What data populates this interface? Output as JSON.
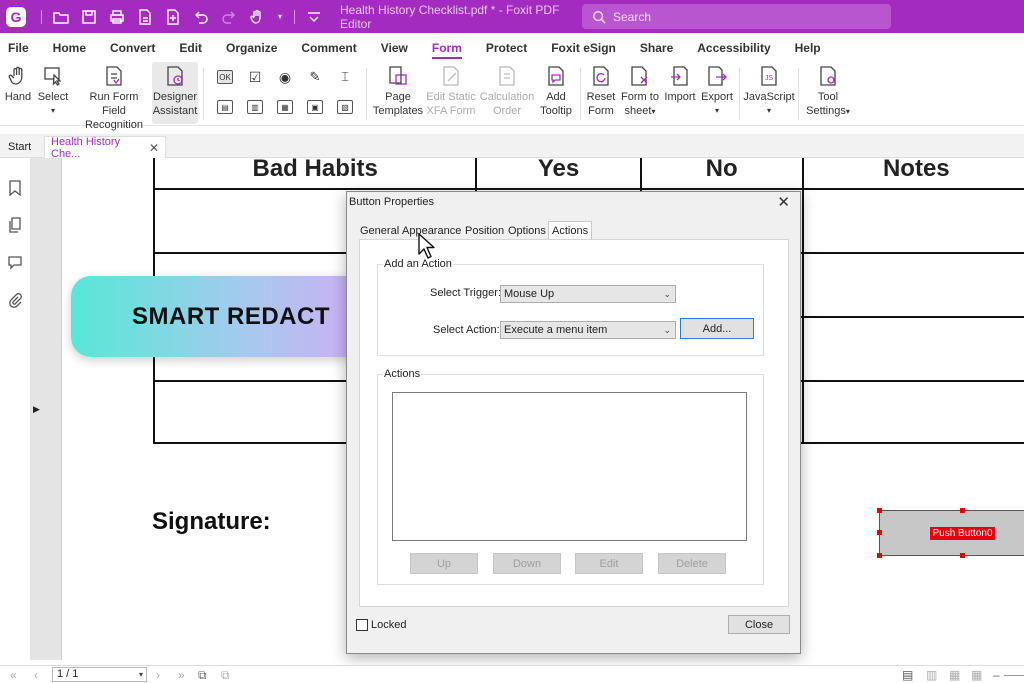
{
  "titlebar": {
    "doc_title": "Health History Checklist.pdf * - Foxit PDF Editor",
    "search_placeholder": "Search"
  },
  "menu": [
    "File",
    "Home",
    "Convert",
    "Edit",
    "Organize",
    "Comment",
    "View",
    "Form",
    "Protect",
    "Foxit eSign",
    "Share",
    "Accessibility",
    "Help"
  ],
  "active_menu": "Form",
  "ribbon": {
    "hand": "Hand",
    "select": "Select",
    "run_form_1": "Run Form Field",
    "run_form_2": "Recognition",
    "designer_1": "Designer",
    "designer_2": "Assistant",
    "page_templates_1": "Page",
    "page_templates_2": "Templates",
    "edit_static_1": "Edit Static",
    "edit_static_2": "XFA Form",
    "calc_order_1": "Calculation",
    "calc_order_2": "Order",
    "add_tooltip_1": "Add",
    "add_tooltip_2": "Tooltip",
    "reset_form_1": "Reset",
    "reset_form_2": "Form",
    "form_to_sheet_1": "Form to",
    "form_to_sheet_2": "sheet",
    "import": "Import",
    "export": "Export",
    "javascript": "JavaScript",
    "tool_settings_1": "Tool",
    "tool_settings_2": "Settings",
    "ok_icon_text": "OK"
  },
  "tabs": {
    "start": "Start",
    "doc": "Health History Che..."
  },
  "document": {
    "headers": [
      "Bad Habits",
      "Yes",
      "No",
      "Notes"
    ],
    "signature": "Signature:",
    "push_button": "Push Button0"
  },
  "overlay": {
    "smart_redact": "SMART REDACT"
  },
  "dialog": {
    "title": "Button Properties",
    "tabs": [
      "General",
      "Appearance",
      "Position",
      "Options",
      "Actions"
    ],
    "active_tab": "Actions",
    "add_action_group": "Add an Action",
    "select_trigger_label": "Select Trigger:",
    "select_trigger_value": "Mouse Up",
    "select_action_label": "Select Action:",
    "select_action_value": "Execute a menu item",
    "add_button": "Add...",
    "actions_group": "Actions",
    "up": "Up",
    "down": "Down",
    "edit": "Edit",
    "delete": "Delete",
    "locked": "Locked",
    "close": "Close"
  },
  "statusbar": {
    "page": "1 / 1"
  }
}
